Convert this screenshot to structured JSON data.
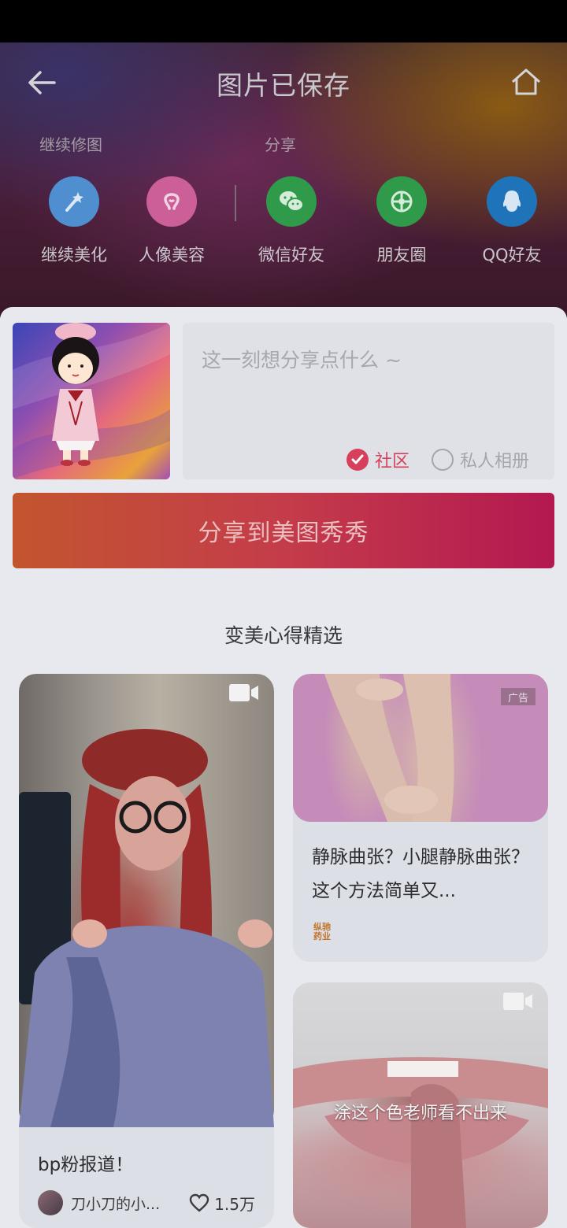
{
  "header": {
    "title": "图片已保存",
    "continue_label": "继续修图",
    "share_label": "分享"
  },
  "actions": [
    {
      "label": "继续美化",
      "icon": "magic-wand-icon",
      "color": "#4f8fcf"
    },
    {
      "label": "人像美容",
      "icon": "face-icon",
      "color": "#cc5f97"
    },
    {
      "label": "微信好友",
      "icon": "wechat-icon",
      "color": "#2f9a4a"
    },
    {
      "label": "朋友圈",
      "icon": "moments-icon",
      "color": "#2f9a4a"
    },
    {
      "label": "QQ好友",
      "icon": "qq-icon",
      "color": "#1f73b8"
    }
  ],
  "compose": {
    "placeholder": "这一刻想分享点什么 ~",
    "option_community": "社区",
    "option_private": "私人相册"
  },
  "share_button": "分享到美图秀秀",
  "feed": {
    "title": "变美心得精选",
    "cards": [
      {
        "desc": "bp粉报道！",
        "author": "刀小刀的小...",
        "likes": "1.5万"
      },
      {
        "desc": "静脉曲张？小腿静脉曲张？这个方法简单又...",
        "ad": "广告",
        "brand": "纵驰药业"
      },
      {
        "caption": "涂这个色老师看不出来"
      }
    ]
  },
  "colors": {
    "accent": "#d6405c",
    "share_gradient_start": "#c2552f",
    "share_gradient_end": "#b31850"
  }
}
